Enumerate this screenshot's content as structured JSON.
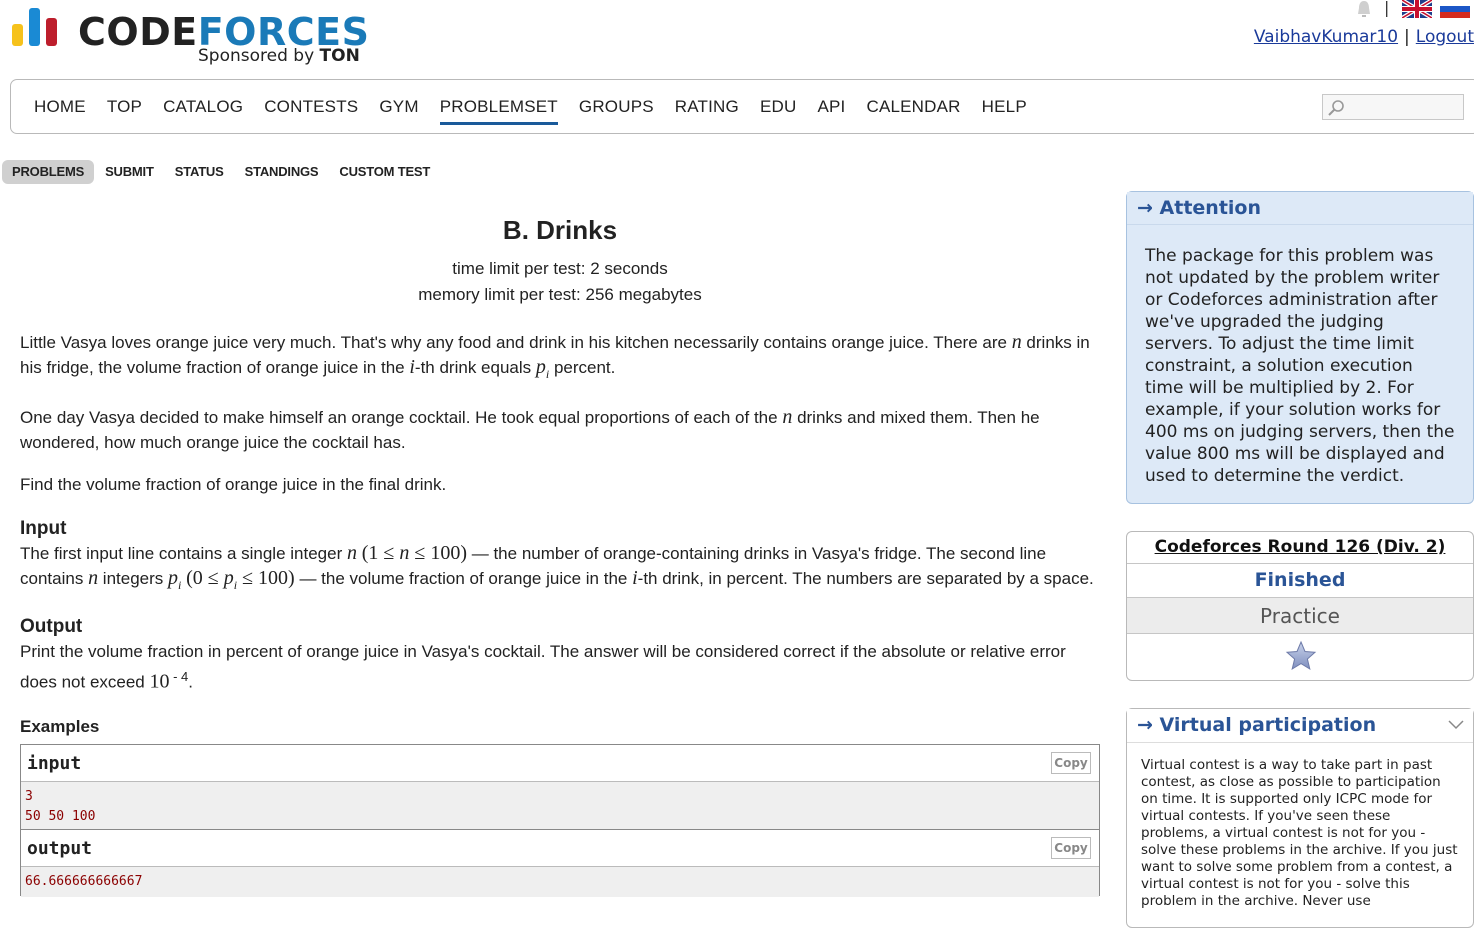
{
  "header": {
    "logo_word1": "CODE",
    "logo_word2": "FORCES",
    "sponsor_prefix": "Sponsored by",
    "sponsor_name": "TON",
    "username": "VaibhavKumar10",
    "separator": "|",
    "logout": "Logout"
  },
  "main_menu": {
    "items": [
      "HOME",
      "TOP",
      "CATALOG",
      "CONTESTS",
      "GYM",
      "PROBLEMSET",
      "GROUPS",
      "RATING",
      "EDU",
      "API",
      "CALENDAR",
      "HELP"
    ],
    "active": "PROBLEMSET",
    "search_value": ""
  },
  "second_menu": {
    "items": [
      "PROBLEMS",
      "SUBMIT",
      "STATUS",
      "STANDINGS",
      "CUSTOM TEST"
    ],
    "selected": "PROBLEMS"
  },
  "problem": {
    "title": "B. Drinks",
    "time_limit_label": "time limit per test:",
    "time_limit_value": "2 seconds",
    "memory_limit_label": "memory limit per test:",
    "memory_limit_value": "256 megabytes",
    "p1_a": "Little Vasya loves orange juice very much. That's why any food and drink in his kitchen necessarily contains orange juice. There are",
    "p1_n": "n",
    "p1_b": "drinks in his fridge, the volume fraction of orange juice in the",
    "p1_i": "i",
    "p1_c": "-th drink equals",
    "p1_p": "p",
    "p1_sub": "i",
    "p1_d": "percent.",
    "p2_a": "One day Vasya decided to make himself an orange cocktail. He took equal proportions of each of the",
    "p2_n": "n",
    "p2_b": "drinks and mixed them. Then he wondered, how much orange juice the cocktail has.",
    "p3": "Find the volume fraction of orange juice in the final drink.",
    "input_title": "Input",
    "input_a": "The first input line contains a single integer",
    "input_n": "n",
    "input_constraint1_open": "(1 ≤",
    "input_constraint1_n": "n",
    "input_constraint1_close": "≤ 100)",
    "input_b": "— the number of orange-containing drinks in Vasya's fridge. The second line contains",
    "input_n2": "n",
    "input_c": "integers",
    "input_p": "p",
    "input_sub": "i",
    "input_constraint2_open": "(0 ≤",
    "input_constraint2_p": "p",
    "input_constraint2_sub": "i",
    "input_constraint2_close": "≤ 100)",
    "input_d": "— the volume fraction of orange juice in the",
    "input_i": "i",
    "input_e": "-th drink, in percent. The numbers are separated by a space.",
    "output_title": "Output",
    "output_a": "Print the volume fraction in percent of orange juice in Vasya's cocktail. The answer will be considered correct if the absolute or relative error does not exceed",
    "output_base": "10",
    "output_exp": " - 4",
    "output_end": ".",
    "examples_title": "Examples",
    "input_label": "input",
    "output_label": "output",
    "copy_label": "Copy",
    "sample_input": "3\n50 50 100",
    "sample_output": "66.666666666667"
  },
  "sidebar": {
    "attention_title": "→ Attention",
    "attention_text": "The package for this problem was not updated by the problem writer or Codeforces administration after we've upgraded the judging servers. To adjust the time limit constraint, a solution execution time will be multiplied by 2. For example, if your solution works for 400 ms on judging servers, then the value 800 ms will be displayed and used to determine the verdict.",
    "round_title": "Codeforces Round 126 (Div. 2)",
    "round_status": "Finished",
    "round_practice": "Practice",
    "virtual_title": "→ Virtual participation",
    "virtual_text": "Virtual contest is a way to take part in past contest, as close as possible to participation on time. It is supported only ICPC mode for virtual contests. If you've seen these problems, a virtual contest is not for you - solve these problems in the archive. If you just want to solve some problem from a contest, a virtual contest is not for you - solve this problem in the archive. Never use"
  },
  "colors": {
    "accent_blue": "#2a5496",
    "menu_active_underline": "#1a5a9a",
    "attention_bg": "#dde9f7",
    "sample_text": "#8b0000"
  }
}
